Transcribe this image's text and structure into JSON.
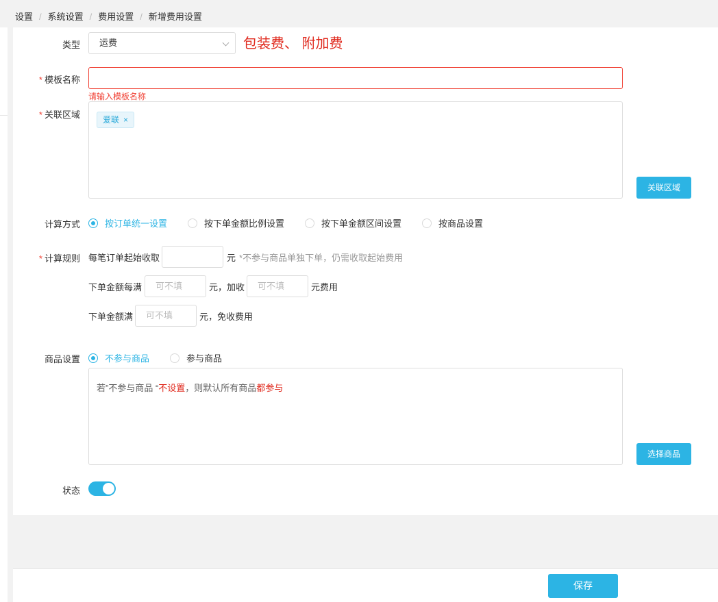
{
  "breadcrumb": [
    "设置",
    "系统设置",
    "费用设置",
    "新增费用设置"
  ],
  "form": {
    "type_label": "类型",
    "type_value": "运费",
    "type_note": "包装费、 附加费",
    "name_label": "模板名称",
    "name_error": "请输入模板名称",
    "region_label": "关联区域",
    "region_tags": [
      "爱联"
    ],
    "region_button": "关联区域",
    "calc_label": "计算方式",
    "calc_options": [
      "按订单统一设置",
      "按下单金额比例设置",
      "按下单金额区间设置",
      "按商品设置"
    ],
    "rule_label": "计算规则",
    "rule1_prefix": "每笔订单起始收取",
    "rule1_unit": "元",
    "rule1_note": "*不参与商品单独下单，仍需收取起始费用",
    "rule2_prefix": "下单金额每满",
    "rule2_mid": "元，加收",
    "rule2_suffix": "元费用",
    "rule3_prefix": "下单金额满",
    "rule3_suffix": "元，免收费用",
    "placeholder": "可不填",
    "goods_label": "商品设置",
    "goods_options": [
      "不参与商品",
      "参与商品"
    ],
    "goods_hint_a": "若”不参与商品 “",
    "goods_hint_b": "不设置",
    "goods_hint_c": "，则默认所有商品",
    "goods_hint_d": "都参与",
    "goods_button": "选择商品",
    "status_label": "状态"
  },
  "footer": {
    "save_label": "保存"
  },
  "colors": {
    "accent": "#2cb4e4",
    "error": "#f04134",
    "note_red": "#e02b1f"
  }
}
